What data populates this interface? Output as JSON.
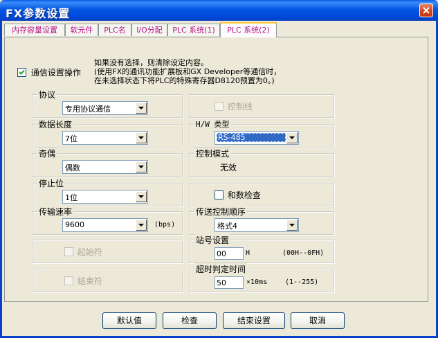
{
  "window": {
    "title": "FX参数设置"
  },
  "tabs": [
    {
      "label": "内存容量设置",
      "active": false
    },
    {
      "label": "软元件",
      "active": false
    },
    {
      "label": "PLC名",
      "active": false
    },
    {
      "label": "I/O分配",
      "active": false
    },
    {
      "label": "PLC 系统(1)",
      "active": false
    },
    {
      "label": "PLC 系统(2)",
      "active": true
    }
  ],
  "comm": {
    "checkbox_label": "通信设置操作",
    "checked": true,
    "note_lines": [
      "如果没有选择，则清除设定内容。",
      "(使用FX的通讯功能扩展板和GX Developer等通信时，",
      "在未选择状态下将PLC的特殊寄存器D8120预置为0。)"
    ]
  },
  "left": {
    "protocol": {
      "label": "协议",
      "value": "专用协议通信"
    },
    "data_length": {
      "label": "数据长度",
      "value": "7位"
    },
    "parity": {
      "label": "奇偶",
      "value": "偶数"
    },
    "stop_bit": {
      "label": "停止位",
      "value": "1位"
    },
    "baud_rate": {
      "label": "传输速率",
      "value": "9600",
      "unit": "(bps)"
    },
    "header": {
      "label": "起始符"
    },
    "terminator": {
      "label": "结束符"
    }
  },
  "right": {
    "control_line": {
      "label": "控制线"
    },
    "hw_type": {
      "label": "H/W 类型",
      "value": "RS-485"
    },
    "control_mode": {
      "label": "控制模式",
      "value": "无效"
    },
    "sum_check": {
      "label": "和数检查"
    },
    "transmission_control": {
      "label": "传送控制顺序",
      "value": "格式4"
    },
    "station_number": {
      "label": "站号设置",
      "value": "00",
      "suffix": "H",
      "range": "(00H--0FH)"
    },
    "timeout": {
      "label": "超时判定时间",
      "value": "50",
      "suffix": "×10ms",
      "range": "(1--255)"
    }
  },
  "buttons": {
    "default": "默认值",
    "check": "检查",
    "finish": "结束设置",
    "cancel": "取消"
  },
  "colors": {
    "title_bar": "#0054e3",
    "tab_text": "#b9128a",
    "dialog_bg": "#ece9d8",
    "close_button": "#d5421a"
  }
}
